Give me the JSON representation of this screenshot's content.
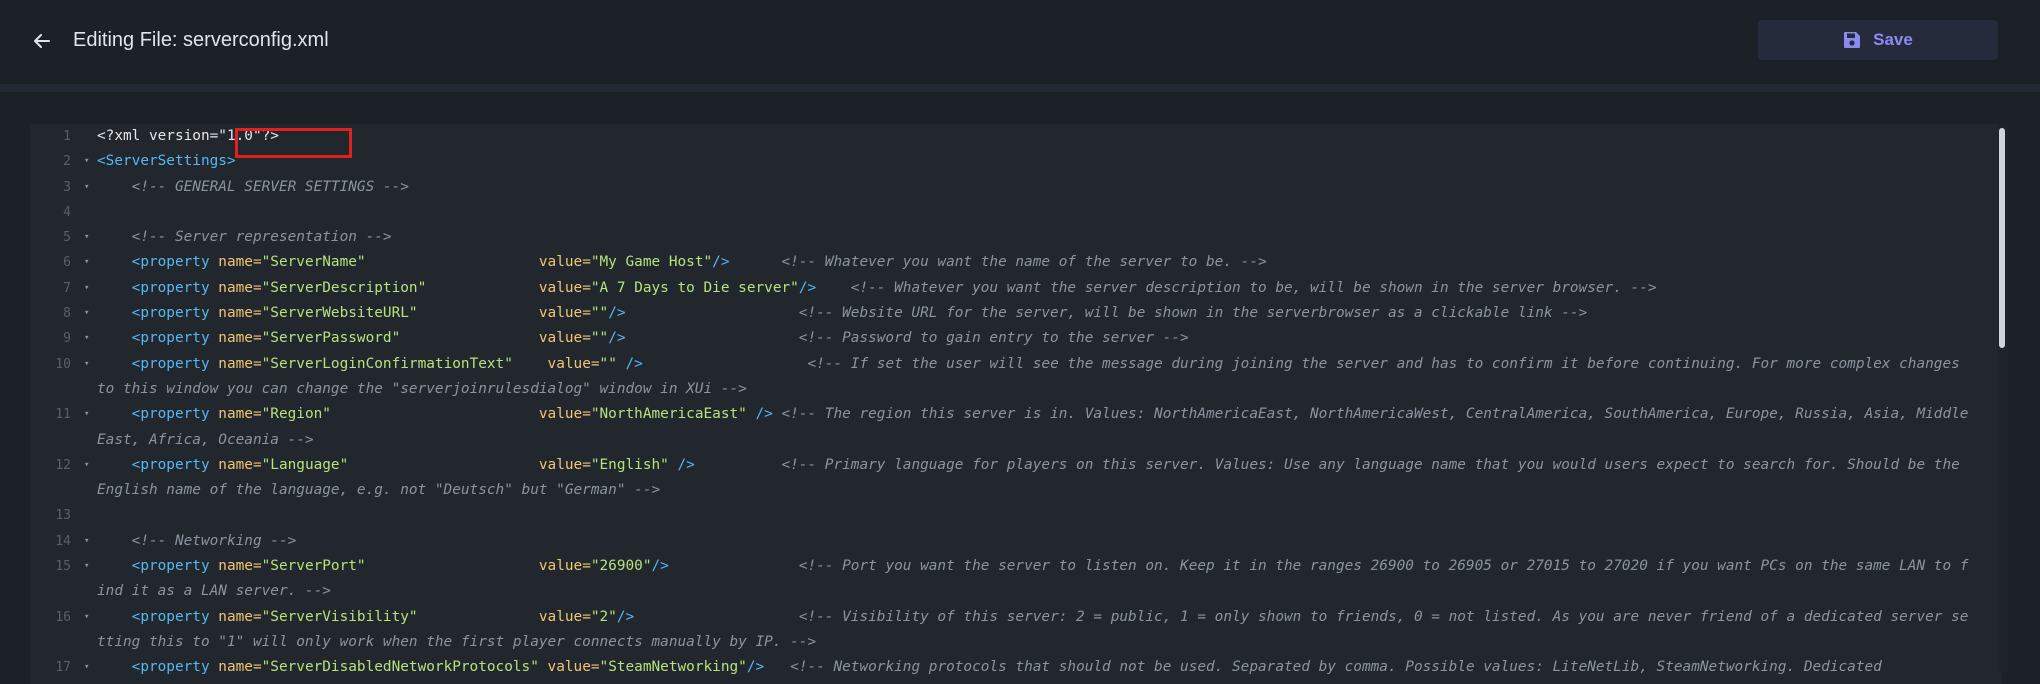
{
  "header": {
    "title": "Editing File: serverconfig.xml",
    "save_label": "Save",
    "back_icon": "arrow-left-icon",
    "save_icon": "floppy-disk-icon"
  },
  "colors": {
    "accent": "#8b8af0",
    "background": "#1c2128",
    "editor_background": "#22272e",
    "highlight_border": "#e0221f"
  },
  "editor": {
    "lines": [
      {
        "num": "1",
        "fold": false,
        "tokens": [
          {
            "t": "plain",
            "v": "<?xml version=\"1.0\"?>"
          }
        ]
      },
      {
        "num": "2",
        "fold": true,
        "tokens": [
          {
            "t": "tag",
            "v": "<ServerSettings>"
          }
        ]
      },
      {
        "num": "3",
        "fold": true,
        "tokens": [
          {
            "t": "plain",
            "v": "    "
          },
          {
            "t": "cmt",
            "v": "<!-- GENERAL SERVER SETTINGS -->"
          }
        ]
      },
      {
        "num": "4",
        "fold": false,
        "tokens": [
          {
            "t": "plain",
            "v": " "
          }
        ]
      },
      {
        "num": "5",
        "fold": true,
        "tokens": [
          {
            "t": "plain",
            "v": "    "
          },
          {
            "t": "cmt",
            "v": "<!-- Server representation -->"
          }
        ]
      },
      {
        "num": "6",
        "fold": true,
        "tokens": [
          {
            "t": "plain",
            "v": "    "
          },
          {
            "t": "tag",
            "v": "<property "
          },
          {
            "t": "attr",
            "v": "name="
          },
          {
            "t": "str",
            "v": "\"ServerName\""
          },
          {
            "t": "plain",
            "v": "                    "
          },
          {
            "t": "attr",
            "v": "value="
          },
          {
            "t": "str",
            "v": "\"My Game Host\""
          },
          {
            "t": "tag",
            "v": "/>"
          },
          {
            "t": "plain",
            "v": "      "
          },
          {
            "t": "cmt",
            "v": "<!-- Whatever you want the name of the server to be. -->"
          }
        ]
      },
      {
        "num": "7",
        "fold": true,
        "tokens": [
          {
            "t": "plain",
            "v": "    "
          },
          {
            "t": "tag",
            "v": "<property "
          },
          {
            "t": "attr",
            "v": "name="
          },
          {
            "t": "str",
            "v": "\"ServerDescription\""
          },
          {
            "t": "plain",
            "v": "             "
          },
          {
            "t": "attr",
            "v": "value="
          },
          {
            "t": "str",
            "v": "\"A 7 Days to Die server\""
          },
          {
            "t": "tag",
            "v": "/>"
          },
          {
            "t": "plain",
            "v": "    "
          },
          {
            "t": "cmt",
            "v": "<!-- Whatever you want the server description to be, will be shown in the server browser. -->"
          }
        ]
      },
      {
        "num": "8",
        "fold": true,
        "tokens": [
          {
            "t": "plain",
            "v": "    "
          },
          {
            "t": "tag",
            "v": "<property "
          },
          {
            "t": "attr",
            "v": "name="
          },
          {
            "t": "str",
            "v": "\"ServerWebsiteURL\""
          },
          {
            "t": "plain",
            "v": "              "
          },
          {
            "t": "attr",
            "v": "value="
          },
          {
            "t": "str",
            "v": "\"\""
          },
          {
            "t": "tag",
            "v": "/>"
          },
          {
            "t": "plain",
            "v": "                    "
          },
          {
            "t": "cmt",
            "v": "<!-- Website URL for the server, will be shown in the serverbrowser as a clickable link -->"
          }
        ]
      },
      {
        "num": "9",
        "fold": true,
        "tokens": [
          {
            "t": "plain",
            "v": "    "
          },
          {
            "t": "tag",
            "v": "<property "
          },
          {
            "t": "attr",
            "v": "name="
          },
          {
            "t": "str",
            "v": "\"ServerPassword\""
          },
          {
            "t": "plain",
            "v": "                "
          },
          {
            "t": "attr",
            "v": "value="
          },
          {
            "t": "str",
            "v": "\"\""
          },
          {
            "t": "tag",
            "v": "/>"
          },
          {
            "t": "plain",
            "v": "                    "
          },
          {
            "t": "cmt",
            "v": "<!-- Password to gain entry to the server -->"
          }
        ]
      },
      {
        "num": "10",
        "fold": true,
        "tokens": [
          {
            "t": "plain",
            "v": "    "
          },
          {
            "t": "tag",
            "v": "<property "
          },
          {
            "t": "attr",
            "v": "name="
          },
          {
            "t": "str",
            "v": "\"ServerLoginConfirmationText\""
          },
          {
            "t": "plain",
            "v": "    "
          },
          {
            "t": "attr",
            "v": "value="
          },
          {
            "t": "str",
            "v": "\"\""
          },
          {
            "t": "tag",
            "v": " />"
          },
          {
            "t": "plain",
            "v": "                   "
          },
          {
            "t": "cmt",
            "v": "<!-- If set the user will see the message during joining the server and has to confirm it before continuing. For more complex changes to this window you can change the \"serverjoinrulesdialog\" window in XUi -->"
          }
        ]
      },
      {
        "num": "11",
        "fold": true,
        "tokens": [
          {
            "t": "plain",
            "v": "    "
          },
          {
            "t": "tag",
            "v": "<property "
          },
          {
            "t": "attr",
            "v": "name="
          },
          {
            "t": "str",
            "v": "\"Region\""
          },
          {
            "t": "plain",
            "v": "                        "
          },
          {
            "t": "attr",
            "v": "value="
          },
          {
            "t": "str",
            "v": "\"NorthAmericaEast\""
          },
          {
            "t": "tag",
            "v": " />"
          },
          {
            "t": "plain",
            "v": " "
          },
          {
            "t": "cmt",
            "v": "<!-- The region this server is in. Values: NorthAmericaEast, NorthAmericaWest, CentralAmerica, SouthAmerica, Europe, Russia, Asia, MiddleEast, Africa, Oceania -->"
          }
        ]
      },
      {
        "num": "12",
        "fold": true,
        "tokens": [
          {
            "t": "plain",
            "v": "    "
          },
          {
            "t": "tag",
            "v": "<property "
          },
          {
            "t": "attr",
            "v": "name="
          },
          {
            "t": "str",
            "v": "\"Language\""
          },
          {
            "t": "plain",
            "v": "                      "
          },
          {
            "t": "attr",
            "v": "value="
          },
          {
            "t": "str",
            "v": "\"English\""
          },
          {
            "t": "tag",
            "v": " />"
          },
          {
            "t": "plain",
            "v": "          "
          },
          {
            "t": "cmt",
            "v": "<!-- Primary language for players on this server. Values: Use any language name that you would users expect to search for. Should be the English name of the language, e.g. not \"Deutsch\" but \"German\" -->"
          }
        ]
      },
      {
        "num": "13",
        "fold": false,
        "tokens": [
          {
            "t": "plain",
            "v": " "
          }
        ]
      },
      {
        "num": "14",
        "fold": true,
        "tokens": [
          {
            "t": "plain",
            "v": "    "
          },
          {
            "t": "cmt",
            "v": "<!-- Networking -->"
          }
        ]
      },
      {
        "num": "15",
        "fold": true,
        "tokens": [
          {
            "t": "plain",
            "v": "    "
          },
          {
            "t": "tag",
            "v": "<property "
          },
          {
            "t": "attr",
            "v": "name="
          },
          {
            "t": "str",
            "v": "\"ServerPort\""
          },
          {
            "t": "plain",
            "v": "                    "
          },
          {
            "t": "attr",
            "v": "value="
          },
          {
            "t": "str",
            "v": "\"26900\""
          },
          {
            "t": "tag",
            "v": "/>"
          },
          {
            "t": "plain",
            "v": "               "
          },
          {
            "t": "cmt",
            "v": "<!-- Port you want the server to listen on. Keep it in the ranges 26900 to 26905 or 27015 to 27020 if you want PCs on the same LAN to find it as a LAN server. -->"
          }
        ]
      },
      {
        "num": "16",
        "fold": true,
        "tokens": [
          {
            "t": "plain",
            "v": "    "
          },
          {
            "t": "tag",
            "v": "<property "
          },
          {
            "t": "attr",
            "v": "name="
          },
          {
            "t": "str",
            "v": "\"ServerVisibility\""
          },
          {
            "t": "plain",
            "v": "              "
          },
          {
            "t": "attr",
            "v": "value="
          },
          {
            "t": "str",
            "v": "\"2\""
          },
          {
            "t": "tag",
            "v": "/>"
          },
          {
            "t": "plain",
            "v": "                   "
          },
          {
            "t": "cmt",
            "v": "<!-- Visibility of this server: 2 = public, 1 = only shown to friends, 0 = not listed. As you are never friend of a dedicated server setting this to \"1\" will only work when the first player connects manually by IP. -->"
          }
        ]
      },
      {
        "num": "17",
        "fold": true,
        "tokens": [
          {
            "t": "plain",
            "v": "    "
          },
          {
            "t": "tag",
            "v": "<property "
          },
          {
            "t": "attr",
            "v": "name="
          },
          {
            "t": "str",
            "v": "\"ServerDisabledNetworkProtocols\""
          },
          {
            "t": "plain",
            "v": " "
          },
          {
            "t": "attr",
            "v": "value="
          },
          {
            "t": "str",
            "v": "\"SteamNetworking\""
          },
          {
            "t": "tag",
            "v": "/>"
          },
          {
            "t": "plain",
            "v": "   "
          },
          {
            "t": "cmt",
            "v": "<!-- Networking protocols that should not be used. Separated by comma. Possible values: LiteNetLib, SteamNetworking. Dedicated"
          }
        ]
      }
    ]
  }
}
